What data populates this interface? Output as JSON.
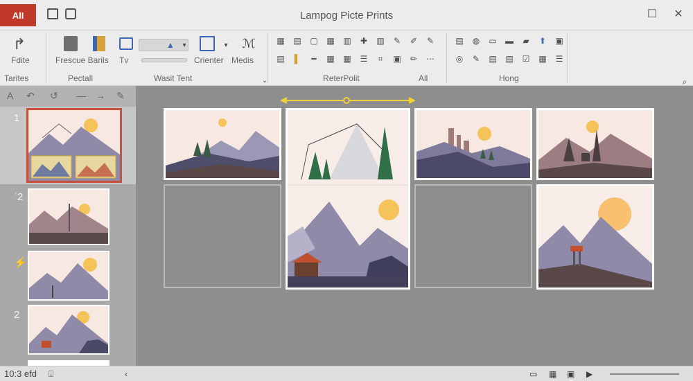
{
  "window": {
    "title": "Lampog Picte Prints",
    "app_badge": "AlI"
  },
  "ribbon": {
    "left_button_label": "Fdite",
    "left_group": "Tarites",
    "btn_frescue": "Frescue Barils",
    "btn_tv": "Tv",
    "btn_crienter": "Crienter",
    "btn_medis": "Medis",
    "group_pectall": "Pectall",
    "group_wasit": "Wasit Tent",
    "group_reterpolt": "ReterPolit",
    "group_all": "All",
    "group_hong": "Hong"
  },
  "status": {
    "left_text": "10:3 efd"
  },
  "thumbnails": [
    {
      "num": "1"
    },
    {
      "num": "ʿ2"
    },
    {
      "num": "⚡"
    },
    {
      "num": "2"
    }
  ],
  "colors": {
    "accent": "#c0392b",
    "highlight_arrow": "#f0d23a",
    "mountain": "#8e8aa8",
    "sun": "#f5c35a",
    "ground": "#5a4a4a"
  }
}
